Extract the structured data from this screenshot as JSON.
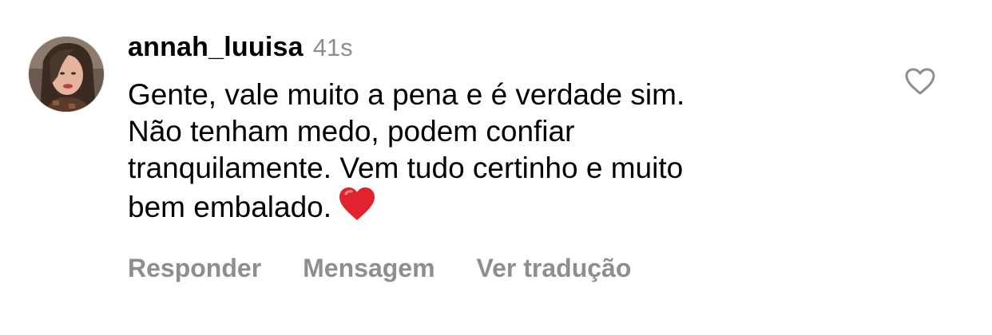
{
  "comment": {
    "username": "annah_luuisa",
    "time": "41s",
    "text_lines": [
      "Gente, vale muito a pena e é verdade sim.",
      "Não tenham medo, podem confiar",
      "tranquilamente. Vem tudo certinho e muito",
      "bem embalado."
    ],
    "emoji": "red-heart-emoji"
  },
  "actions": {
    "reply_label": "Responder",
    "message_label": "Mensagem",
    "translate_label": "Ver tradução"
  },
  "icons": {
    "like": "heart-outline-icon",
    "avatar": "profile-photo"
  },
  "colors": {
    "text": "#000000",
    "muted": "#8e8e8e",
    "heart_emoji": "#e0232e"
  }
}
